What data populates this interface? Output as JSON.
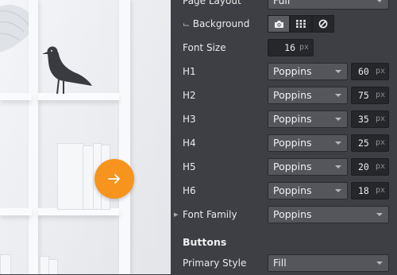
{
  "preview": {
    "next_button_icon": "arrow-right-icon"
  },
  "settings": {
    "page_layout": {
      "label": "Page Layout",
      "value": "Full"
    },
    "background": {
      "label": "Background",
      "options": [
        {
          "name": "image",
          "icon": "camera-icon"
        },
        {
          "name": "pattern",
          "icon": "grid-icon"
        },
        {
          "name": "none",
          "icon": "no-background-icon"
        }
      ]
    },
    "font_size": {
      "label": "Font Size",
      "value": "16",
      "unit": "px"
    },
    "headings": [
      {
        "label": "H1",
        "font": "Poppins",
        "size": "60",
        "unit": "px"
      },
      {
        "label": "H2",
        "font": "Poppins",
        "size": "75",
        "unit": "px"
      },
      {
        "label": "H3",
        "font": "Poppins",
        "size": "35",
        "unit": "px"
      },
      {
        "label": "H4",
        "font": "Poppins",
        "size": "25",
        "unit": "px"
      },
      {
        "label": "H5",
        "font": "Poppins",
        "size": "20",
        "unit": "px"
      },
      {
        "label": "H6",
        "font": "Poppins",
        "size": "18",
        "unit": "px"
      }
    ],
    "font_family": {
      "label": "Font Family",
      "value": "Poppins"
    },
    "buttons_section": "Buttons",
    "primary_style": {
      "label": "Primary Style",
      "value": "Fill"
    }
  },
  "colors": {
    "accent": "#f7941d",
    "panel_bg": "#3e3f44",
    "select_bg": "#55565c",
    "input_bg": "#26272b"
  }
}
